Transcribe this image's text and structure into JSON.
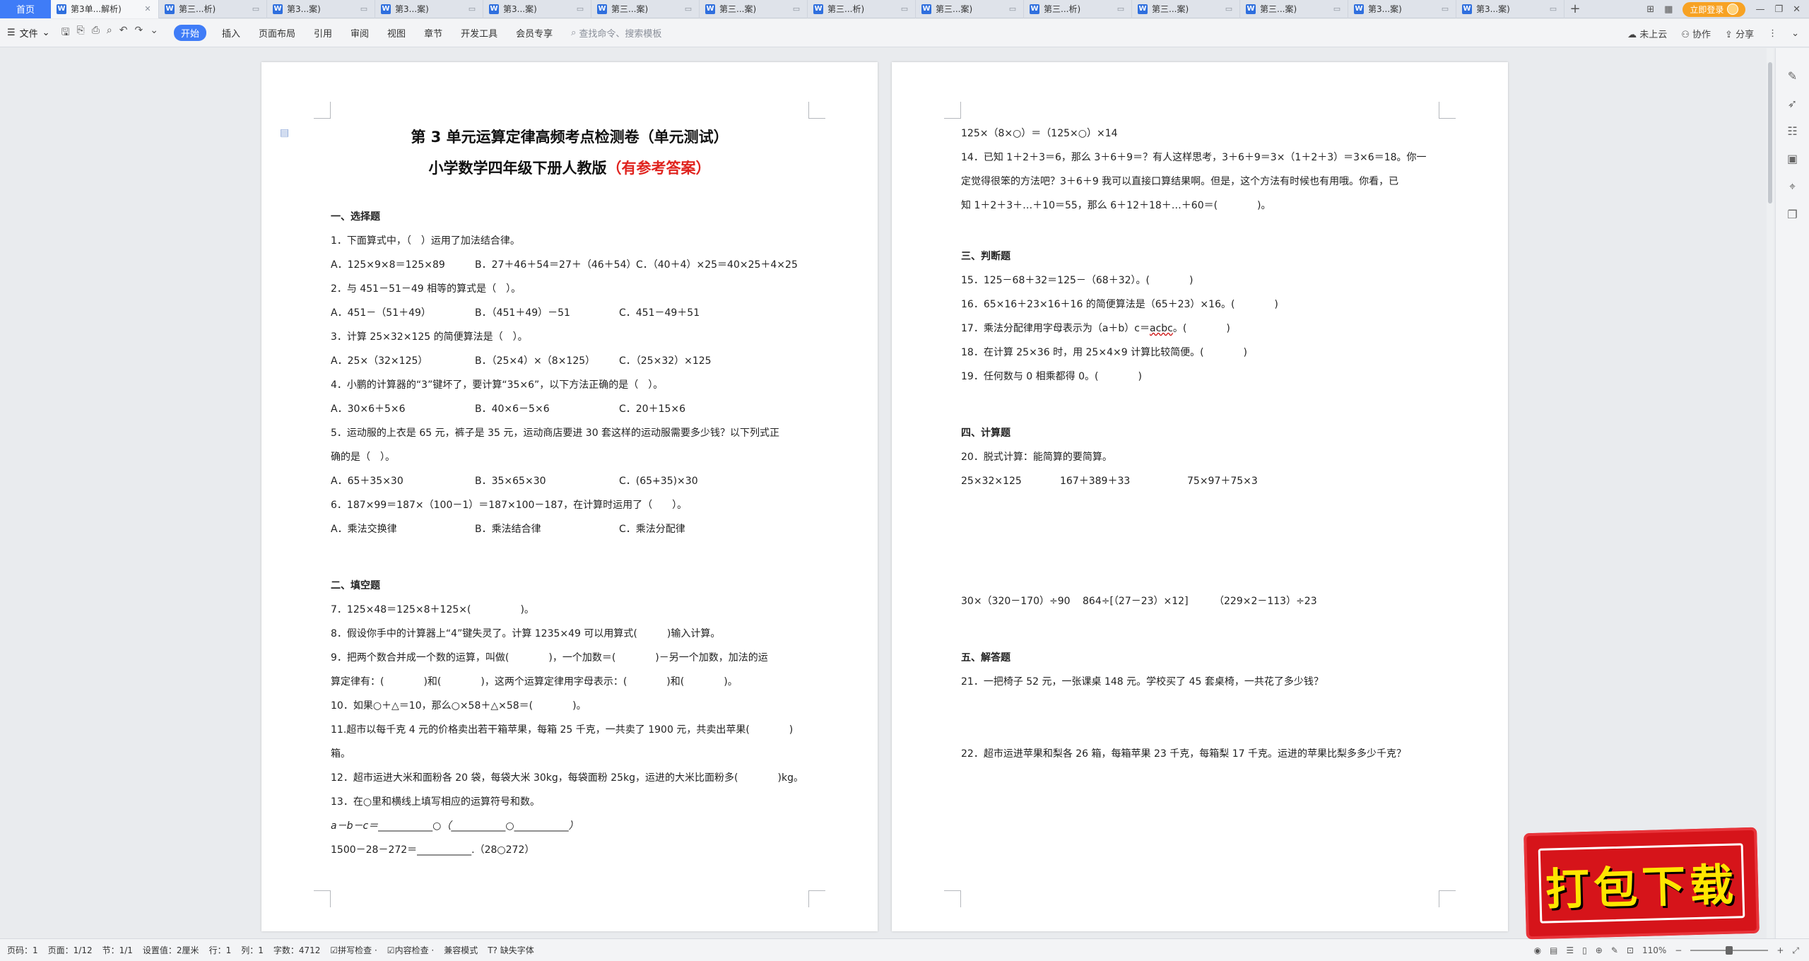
{
  "tabs": {
    "home": "首页",
    "items": [
      {
        "label": "第3单...解析)",
        "active": true
      },
      {
        "label": "第三...析)"
      },
      {
        "label": "第3...案)"
      },
      {
        "label": "第3...案)"
      },
      {
        "label": "第3...案)"
      },
      {
        "label": "第三...案)"
      },
      {
        "label": "第三...案)"
      },
      {
        "label": "第三...析)"
      },
      {
        "label": "第三...案)"
      },
      {
        "label": "第三...析)"
      },
      {
        "label": "第三...案)"
      },
      {
        "label": "第三...案)"
      },
      {
        "label": "第3...案)"
      },
      {
        "label": "第3...案)"
      }
    ],
    "login": "立即登录"
  },
  "menubar": {
    "file": "文件",
    "start": "开始",
    "items": [
      "插入",
      "页面布局",
      "引用",
      "审阅",
      "视图",
      "章节",
      "开发工具",
      "会员专享"
    ],
    "search_placeholder": "查找命令、搜索模板",
    "right": [
      "未上云",
      "协作",
      "分享"
    ]
  },
  "left_page": {
    "title": "第 3 单元运算定律高频考点检测卷（单元测试）",
    "subtitle_main": "小学数学四年级下册人教版",
    "subtitle_red": "（有参考答案）",
    "sec1": "一、选择题",
    "q1": "1．下面算式中，（　）运用了加法结合律。",
    "q1_opts": [
      "A．125×9×8＝125×89",
      "B．27＋46＋54＝27＋（46＋54）",
      "C．（40＋4）×25＝40×25＋4×25"
    ],
    "q2": "2．与 451－51－49 相等的算式是（　）。",
    "q2_opts": [
      "A．451－（51＋49）",
      "B．（451＋49）－51",
      "C．451－49＋51"
    ],
    "q3": "3．计算 25×32×125 的简便算法是（　）。",
    "q3_opts": [
      "A．25×（32×125）",
      "B．（25×4）×（8×125）",
      "C．（25×32）×125"
    ],
    "q4": "4．小鹏的计算器的“3”键坏了，要计算“35×6”，以下方法正确的是（　）。",
    "q4_opts": [
      "A．30×6＋5×6",
      "B．40×6－5×6",
      "C．20＋15×6"
    ],
    "q5a": "5．运动服的上衣是 65 元，裤子是 35 元，运动商店要进 30 套这样的运动服需要多少钱？以下列式正",
    "q5b": "确的是（　）。",
    "q5_opts": [
      "A．65＋35×30",
      "B．35×65×30",
      "C．(65+35)×30"
    ],
    "q6": "6．187×99＝187×（100－1）＝187×100－187，在计算时运用了（　　）。",
    "q6_opts": [
      "A．乘法交换律",
      "B．乘法结合律",
      "C．乘法分配律"
    ],
    "sec2": "二、填空题",
    "q7": "7．125×48＝125×8＋125×(　　　　　)。",
    "q8": "8．假设你手中的计算器上“4”键失灵了。计算 1235×49 可以用算式(　　　)输入计算。",
    "q9a": "9．把两个数合并成一个数的运算，叫做(　　　　)，一个加数＝(　　　　)－另一个加数，加法的运",
    "q9b": "算定律有：(　　　　)和(　　　　)，这两个运算定律用字母表示：(　　　　)和(　　　　)。",
    "q10": "10．如果○＋△＝10，那么○×58＋△×58＝(　　　　)。",
    "q11a": "11.超市以每千克 4 元的价格卖出若干箱苹果，每箱 25 千克，一共卖了 1900 元，共卖出苹果(　　　　)",
    "q11b": "箱。",
    "q12": "12．超市运进大米和面粉各 20 袋，每袋大米 30kg，每袋面粉 25kg，运进的大米比面粉多(　　　　)kg。",
    "q13": "13．在○里和横线上填写相应的运算符号和数。",
    "q13a": "a－b－c＝___________○（___________○___________）",
    "q13b": "1500－28－272＝___________.（28○272）"
  },
  "right_page": {
    "l1": "125×（8×○）＝（125×○）×14",
    "q14a": "14．已知 1＋2＋3＝6，那么 3＋6＋9＝？有人这样思考，3＋6＋9＝3×（1＋2＋3）＝3×6＝18。你一",
    "q14b": "定觉得很笨的方法吧？3＋6＋9 我可以直接口算结果啊。但是，这个方法有时候也有用哦。你看，已",
    "q14c": "知 1＋2＋3＋…＋10＝55，那么 6＋12＋18＋…＋60＝(　　　　)。",
    "sec3": "三、判断题",
    "q15": "15．125－68＋32＝125－（68＋32）。(　　　　)",
    "q16": "16．65×16＋23×16＋16 的简便算法是（65＋23）×16。(　　　　)",
    "q17_pre": "17．乘法分配律用字母表示为（a＋b）c＝",
    "q17_wavy": "acbc",
    "q17_post": "。(　　　　)",
    "q18": "18．在计算 25×36 时，用 25×4×9 计算比较简便。(　　　　)",
    "q19": "19．任何数与 0 相乘都得 0。(　　　　)",
    "sec4": "四、计算题",
    "q20": "20．脱式计算：能简算的要简算。",
    "calc1": [
      "25×32×125",
      "167＋389＋33",
      "75×97＋75×3"
    ],
    "calc2": [
      "30×（320－170）÷90",
      "864÷[（27－23）×12]",
      "（229×2－113）÷23"
    ],
    "sec5": "五、解答题",
    "q21": "21．一把椅子 52 元，一张课桌 148 元。学校买了 45 套桌椅，一共花了多少钱？",
    "q22": "22．超市运进苹果和梨各 26 箱，每箱苹果 23 千克，每箱梨 17 千克。运进的苹果比梨多多少千克？"
  },
  "statusbar": {
    "items": [
      "页码：1",
      "页面：1/12",
      "节：1/1",
      "设置值：2厘米",
      "行：1",
      "列：1",
      "字数：4712",
      "拼写检查 ·",
      "内容检查 ·",
      "兼容模式",
      "缺失字体"
    ],
    "zoom": "110%"
  },
  "promo": {
    "text": "打包下载"
  },
  "colors": {
    "accent": "#3f7cf7",
    "answer_red": "#e0231e",
    "promo_red": "#d6141a",
    "promo_yellow": "#ffe600"
  }
}
